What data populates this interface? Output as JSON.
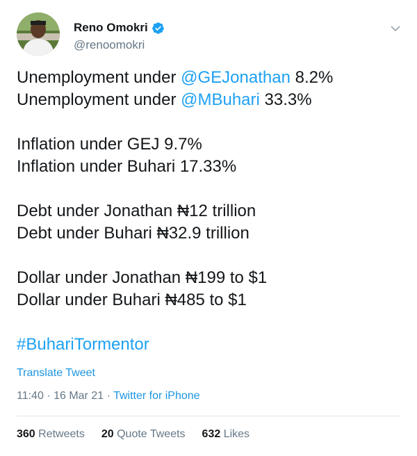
{
  "author": {
    "display_name": "Reno Omokri",
    "handle": "@renoomokri",
    "verified_icon": "verified-badge-icon"
  },
  "tweet": {
    "lines": [
      {
        "pre": "Unemployment under ",
        "mention": "@GEJonathan",
        "post": " 8.2%"
      },
      {
        "pre": "Unemployment under ",
        "mention": "@MBuhari",
        "post": " 33.3%"
      },
      {
        "text": "Inflation under GEJ 9.7%"
      },
      {
        "text": "Inflation under Buhari 17.33%"
      },
      {
        "text": "Debt under Jonathan ₦12 trillion"
      },
      {
        "text": "Debt under Buhari ₦32.9 trillion"
      },
      {
        "text": "Dollar under Jonathan ₦199 to $1"
      },
      {
        "text": "Dollar under Buhari ₦485 to $1"
      }
    ],
    "hashtag": "#BuhariTormentor"
  },
  "translate_label": "Translate Tweet",
  "meta": {
    "time": "11:40",
    "separator": " · ",
    "date": "16 Mar 21",
    "source": "Twitter for iPhone"
  },
  "stats": {
    "retweets_count": "360",
    "retweets_label": "Retweets",
    "quotes_count": "20",
    "quotes_label": "Quote Tweets",
    "likes_count": "632",
    "likes_label": "Likes"
  },
  "colors": {
    "link": "#1da1f2",
    "muted": "#657786",
    "text": "#14171a"
  }
}
